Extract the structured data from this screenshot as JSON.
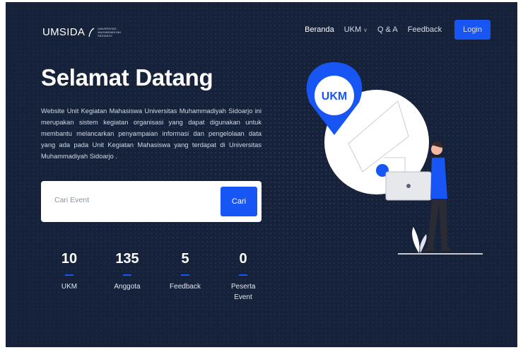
{
  "brand": {
    "name": "UMSIDA",
    "subtitle": "UNIVERSITAS MUHAMMADIYAH SIDOARJO"
  },
  "nav": {
    "items": [
      {
        "label": "Beranda",
        "active": true
      },
      {
        "label": "UKM",
        "dropdown": true
      },
      {
        "label": "Q & A"
      },
      {
        "label": "Feedback"
      }
    ],
    "login_label": "Login"
  },
  "hero": {
    "title": "Selamat Datang",
    "description": "Website Unit Kegiatan Mahasiswa Universitas Muhammadiyah Sidoarjo ini merupakan sistem kegiatan organisasi yang dapat digunakan untuk membantu melancarkan penyampaian informasi dan pengelolaan data yang ada pada Unit Kegiatan Mahasiswa yang terdapat di Universitas Muhammadiyah Sidoarjo ."
  },
  "search": {
    "placeholder": "Cari Event",
    "value": "",
    "button_label": "Cari"
  },
  "stats": [
    {
      "value": "10",
      "label": "UKM"
    },
    {
      "value": "135",
      "label": "Anggota"
    },
    {
      "value": "5",
      "label": "Feedback"
    },
    {
      "value": "0",
      "label": "Peserta Event"
    }
  ],
  "illustration": {
    "badge_text": "UKM"
  },
  "colors": {
    "background": "#16213a",
    "accent": "#1756f5",
    "text": "#ffffff"
  }
}
